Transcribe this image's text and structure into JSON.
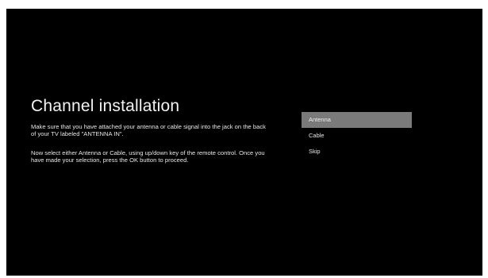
{
  "screen": {
    "title": "Channel installation",
    "paragraphs": [
      "Make sure that you have attached your antenna or cable signal into the jack on the back of your TV labeled \"ANTENNA IN\".",
      "Now select either Antenna or Cable, using up/down key of the remote control. Once you have made your selection, press the OK button to proceed."
    ]
  },
  "menu": {
    "selected_index": 0,
    "items": [
      {
        "label": "Antenna"
      },
      {
        "label": "Cable"
      },
      {
        "label": "Skip"
      }
    ]
  },
  "colors": {
    "background": "#000000",
    "selection_highlight": "#7a7a7a",
    "text": "#f2f2f2"
  }
}
